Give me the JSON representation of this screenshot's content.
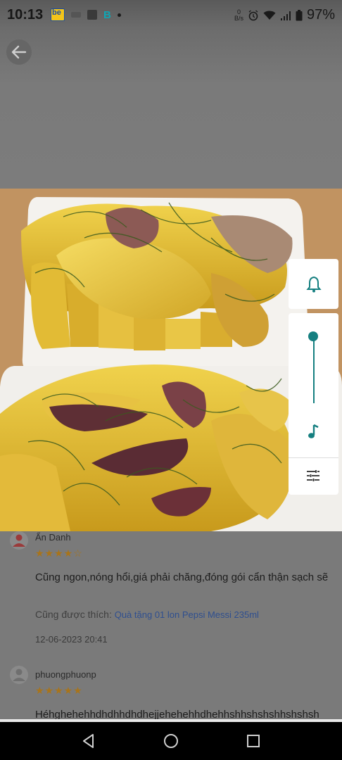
{
  "status_bar": {
    "time": "10:13",
    "net_speed_value": "0",
    "net_speed_unit": "B/s",
    "battery": "97%",
    "icons": [
      "be-app-icon",
      "app-icon",
      "app-icon",
      "b-app-icon",
      "notification-dot",
      "alarm-icon",
      "wifi-icon",
      "signal-icon",
      "battery-icon"
    ],
    "b_icon_text": "B"
  },
  "reviews": [
    {
      "name": "Ẩn Danh",
      "stars": "★★★★☆",
      "text": "Cũng ngon,nóng hổi,giá phải chăng,đóng gói cẩn thận sạch sẽ",
      "also_liked_label": "Cũng được thích: ",
      "also_liked_item": "Quà tặng 01 lon Pepsi Messi 235ml",
      "date": "12-06-2023 20:41"
    },
    {
      "name": "phuongphuonp",
      "stars": "★★★★★",
      "text": "Héhghehehhdhdhhdhdhejjehehehhdhehhshhshshshhshshsh"
    }
  ],
  "volume_panel": {
    "level": 1.0,
    "accent": "#157f80",
    "icons": [
      "bell-icon",
      "music-note-icon",
      "equalizer-settings-icon"
    ]
  },
  "nav_bar": {
    "buttons": [
      "back-triangle-icon",
      "home-circle-icon",
      "recents-square-icon"
    ]
  }
}
